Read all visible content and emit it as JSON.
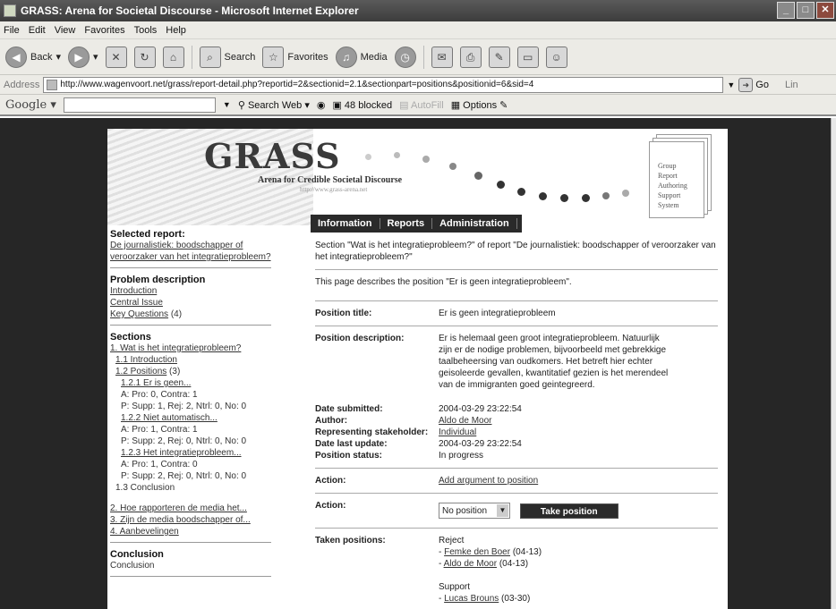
{
  "window": {
    "title": "GRASS: Arena for Societal Discourse - Microsoft Internet Explorer"
  },
  "menu": [
    "File",
    "Edit",
    "View",
    "Favorites",
    "Tools",
    "Help"
  ],
  "toolbar": {
    "back": "Back",
    "search": "Search",
    "favorites": "Favorites",
    "media": "Media"
  },
  "address": {
    "label": "Address",
    "url": "http://www.wagenvoort.net/grass/report-detail.php?reportid=2&sectionid=2.1&sectionpart=positions&positionid=6&sid=4",
    "go": "Go",
    "links": "Lin"
  },
  "google": {
    "logo": "Google",
    "search_web": "Search Web",
    "blocked": "48 blocked",
    "autofill": "AutoFill",
    "options": "Options"
  },
  "header": {
    "logo": "GRASS",
    "tagline": "Arena for Credible Societal Discourse",
    "url": "http://www.grass-arena.net",
    "acronym": [
      "Group",
      "Report",
      "Authoring",
      "Support",
      "System"
    ]
  },
  "nav": [
    "Information",
    "Reports",
    "Administration"
  ],
  "sidebar": {
    "selected_heading": "Selected report:",
    "selected_link": "De journalistiek: boodschapper of veroorzaker van het integratieprobleem?",
    "problem_heading": "Problem description",
    "problem_links": [
      "Introduction",
      "Central Issue",
      "Key Questions"
    ],
    "key_questions_count": "(4)",
    "sections_heading": "Sections",
    "s1": "1. Wat is het integratieprobleem?",
    "s11": "1.1 Introduction",
    "s12": "1.2 Positions",
    "s12_count": "(3)",
    "p121": "1.2.1 Er is geen...",
    "p121_a": "A: Pro: 0, Contra: 1",
    "p121_p": "P: Supp: 1, Rej: 2, Ntrl: 0, No: 0",
    "p122": "1.2.2 Niet automatisch...",
    "p122_a": "A: Pro: 1, Contra: 1",
    "p122_p": "P: Supp: 2, Rej: 0, Ntrl: 0, No: 0",
    "p123": "1.2.3 Het integratieprobleem...",
    "p123_a": "A: Pro: 1, Contra: 0",
    "p123_p": "P: Supp: 2, Rej: 0, Ntrl: 0, No: 0",
    "s13": "1.3 Conclusion",
    "s2": "2. Hoe rapporteren de media het...",
    "s3": "3. Zijn de media boodschapper of...",
    "s4": "4. Aanbevelingen",
    "conclusion_heading": "Conclusion",
    "conclusion_text": "Conclusion"
  },
  "main": {
    "section_intro": "Section \"Wat is het integratieprobleem?\" of report \"De journalistiek: boodschapper of veroorzaker van het integratieprobleem?\"",
    "page_desc": "This page describes the position \"Er is geen integratieprobleem\".",
    "position_title_label": "Position title:",
    "position_title": "Er is geen integratieprobleem",
    "position_desc_label": "Position description:",
    "position_desc": "Er is helemaal geen groot integratieprobleem. Natuurlijk zijn er de nodige problemen, bijvoorbeeld met gebrekkige taalbeheersing van oudkomers. Het betreft hier echter geisoleerde gevallen, kwantitatief gezien is het merendeel van de immigranten goed geintegreerd.",
    "date_submitted_label": "Date submitted:",
    "date_submitted": "2004-03-29 23:22:54",
    "author_label": "Author:",
    "author": "Aldo de Moor",
    "stakeholder_label": "Representing stakeholder:",
    "stakeholder": "Individual",
    "last_update_label": "Date last update:",
    "last_update": "2004-03-29 23:22:54",
    "status_label": "Position status:",
    "status": "In progress",
    "action_label": "Action:",
    "action_link": "Add argument to position",
    "action2_label": "Action:",
    "select_value": "No position",
    "take_position": "Take position",
    "taken_label": "Taken positions:",
    "reject_heading": "Reject",
    "reject": [
      {
        "name": "Femke den Boer",
        "date": "(04-13)"
      },
      {
        "name": "Aldo de Moor",
        "date": "(04-13)"
      }
    ],
    "support_heading": "Support",
    "support": [
      {
        "name": "Lucas Brouns",
        "date": "(03-30)"
      }
    ]
  }
}
